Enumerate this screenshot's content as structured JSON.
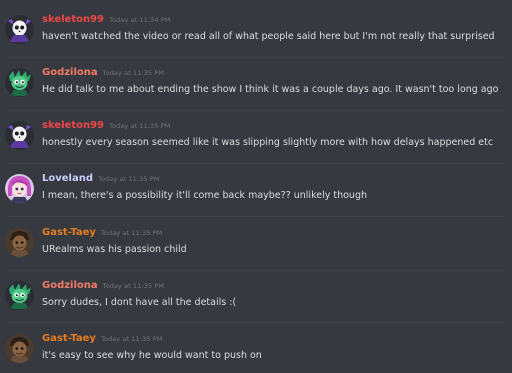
{
  "colors": {
    "background": "#36393f",
    "skeleton99": "#f04747",
    "Godzilona": "#f47b67",
    "Loveland": "#c9cdfb",
    "Gast-Taey": "#e67e22",
    "text": "#dcddde",
    "timestamp": "#72767d"
  },
  "messages": [
    {
      "author": "skeleton99",
      "timestamp": "Today at 11:34 PM",
      "text": "haven't watched the video or read all of what people said here but I'm not really that surprised",
      "avatar_icon": "skull-avatar-icon"
    },
    {
      "author": "Godzilona",
      "timestamp": "Today at 11:35 PM",
      "text": "He did talk to me about ending the show I think it was a couple days ago. It wasn't too long ago",
      "avatar_icon": "green-monster-avatar-icon"
    },
    {
      "author": "skeleton99",
      "timestamp": "Today at 11:35 PM",
      "text": "honestly every season seemed like it was slipping slightly more with how delays happened etc",
      "avatar_icon": "skull-avatar-icon"
    },
    {
      "author": "Loveland",
      "timestamp": "Today at 11:35 PM",
      "text": "I mean, there's a possibility it'll come back maybe?? unlikely though",
      "avatar_icon": "pink-hair-avatar-icon"
    },
    {
      "author": "Gast-Taey",
      "timestamp": "Today at 11:35 PM",
      "text": "URealms was his passion child",
      "avatar_icon": "brown-character-avatar-icon"
    },
    {
      "author": "Godzilona",
      "timestamp": "Today at 11:35 PM",
      "text": "Sorry dudes, I dont have all the details :(",
      "avatar_icon": "green-monster-avatar-icon"
    },
    {
      "author": "Gast-Taey",
      "timestamp": "Today at 11:35 PM",
      "text": "it's easy to see why he would want to push on",
      "avatar_icon": "brown-character-avatar-icon"
    }
  ]
}
